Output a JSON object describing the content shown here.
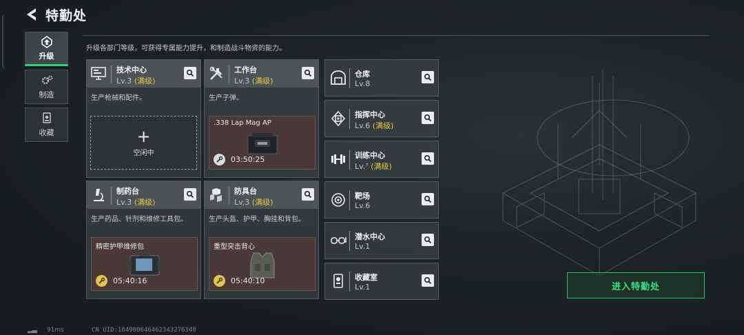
{
  "header": {
    "title": "特勤处"
  },
  "nav": [
    {
      "label": "升级",
      "icon": "upgrade-icon",
      "active": true
    },
    {
      "label": "制造",
      "icon": "gears-icon",
      "active": false
    },
    {
      "label": "收藏",
      "icon": "collection-icon",
      "active": false
    }
  ],
  "description": "升级各部门等级，可获得专属能力提升，和制造战斗物资的能力。",
  "cards": [
    {
      "name": "技术中心",
      "level": "Lv.3",
      "max": "(满级)",
      "desc": "生产枪械和配件。",
      "icon": "monitor-icon",
      "slot": {
        "type": "empty",
        "label": "空闲中"
      }
    },
    {
      "name": "工作台",
      "level": "Lv.3",
      "max": "(满级)",
      "desc": "生产子弹。",
      "icon": "tools-icon",
      "slot": {
        "type": "producing",
        "item": ".338 Lap Mag AP",
        "timer": "03:50:25"
      }
    },
    {
      "name": "制药台",
      "level": "Lv.3",
      "max": "(满级)",
      "desc": "生产药品、针剂和维修工具包。",
      "icon": "microscope-icon",
      "slot": {
        "type": "producing",
        "item": "精密护甲维修包",
        "timer": "05:40:16"
      }
    },
    {
      "name": "防具台",
      "level": "Lv.3",
      "max": "(满级)",
      "desc": "生产头盔、护甲、胸挂和背包。",
      "icon": "armor-icon",
      "slot": {
        "type": "producing",
        "item": "重型突击背心",
        "timer": "05:40:10"
      }
    }
  ],
  "rows": [
    {
      "name": "仓库",
      "level": "Lv.8",
      "max": "",
      "icon": "warehouse-icon"
    },
    {
      "name": "指挥中心",
      "level": "Lv.6",
      "max": "(满级)",
      "icon": "chip-icon"
    },
    {
      "name": "训练中心",
      "level": "Lv.⁷",
      "max": "(满级)",
      "icon": "dumbbell-icon"
    },
    {
      "name": "靶场",
      "level": "Lv.6",
      "max": "",
      "icon": "target-icon"
    },
    {
      "name": "潜水中心",
      "level": "Lv.1",
      "max": "",
      "icon": "goggles-icon"
    },
    {
      "name": "收藏室",
      "level": "Lv.1",
      "max": "",
      "icon": "trophy-icon"
    }
  ],
  "enter_button": "进入特勤处",
  "status": {
    "ping": "91ms",
    "uid": "CN UID:18490064646234​3276348"
  },
  "colors": {
    "accent": "#35d07a",
    "max_level": "#e8c54a",
    "producing_bg": "#4b3939"
  }
}
